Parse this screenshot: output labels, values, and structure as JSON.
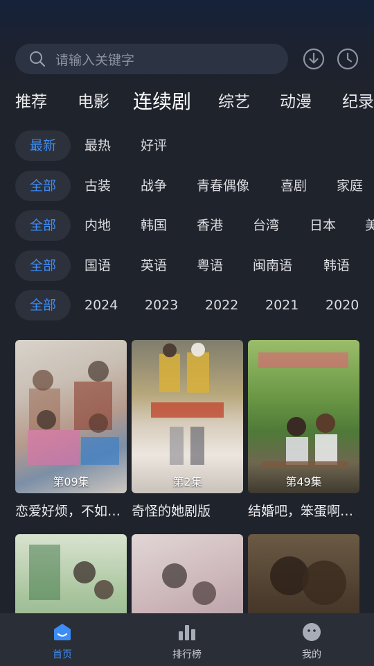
{
  "search": {
    "placeholder": "请输入关键字"
  },
  "category_tabs": [
    "推荐",
    "电影",
    "连续剧",
    "综艺",
    "动漫",
    "纪录"
  ],
  "active_category": "连续剧",
  "filters": {
    "sort": [
      "最新",
      "最热",
      "好评"
    ],
    "genre": [
      "全部",
      "古装",
      "战争",
      "青春偶像",
      "喜剧",
      "家庭"
    ],
    "region": [
      "全部",
      "内地",
      "韩国",
      "香港",
      "台湾",
      "日本",
      "美"
    ],
    "language": [
      "全部",
      "国语",
      "英语",
      "粤语",
      "闽南语",
      "韩语"
    ],
    "year": [
      "全部",
      "2024",
      "2023",
      "2022",
      "2021",
      "2020"
    ]
  },
  "cards": [
    {
      "title": "恋爱好烦，不如…",
      "episode": "第09集"
    },
    {
      "title": "奇怪的她剧版",
      "episode": "第2集"
    },
    {
      "title": "结婚吧，笨蛋啊…",
      "episode": "第49集"
    },
    {
      "title": "",
      "episode": ""
    },
    {
      "title": "",
      "episode": ""
    },
    {
      "title": "",
      "episode": ""
    }
  ],
  "bottom_nav": [
    {
      "label": "首页",
      "icon": "home-icon"
    },
    {
      "label": "排行榜",
      "icon": "chart-icon"
    },
    {
      "label": "我的",
      "icon": "profile-icon"
    }
  ],
  "colors": {
    "accent": "#3d8cf5",
    "background": "#1f232b",
    "chip_bg": "#2c313c",
    "nav_bg": "#2a2e37"
  }
}
